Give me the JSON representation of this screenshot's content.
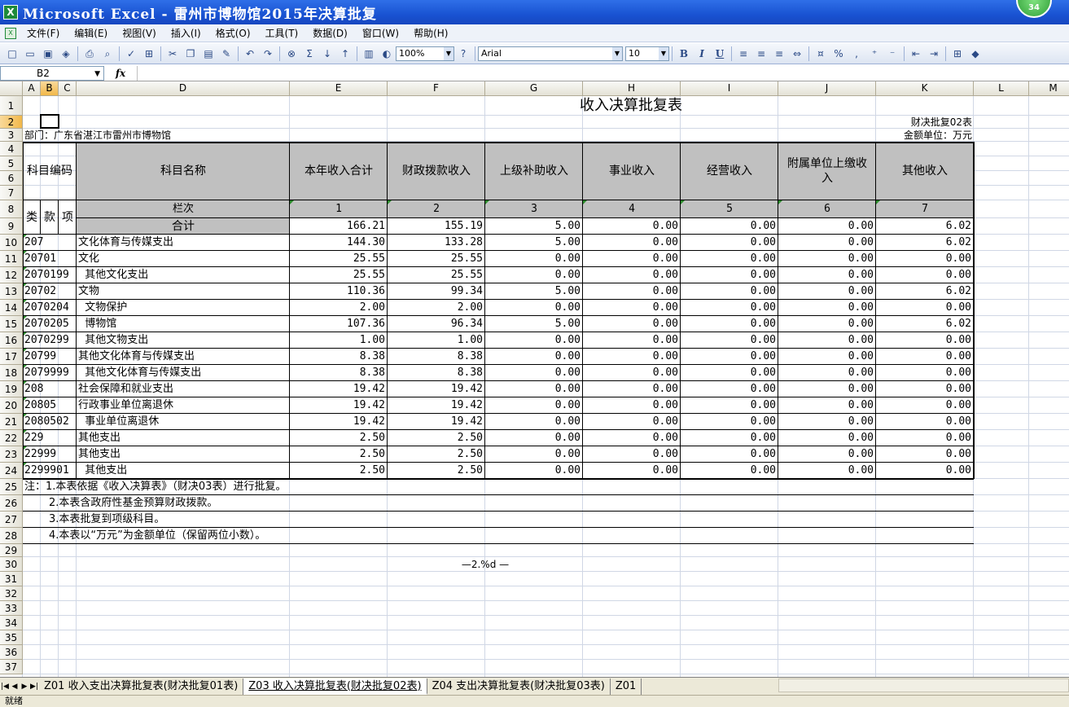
{
  "window": {
    "title": "Microsoft Excel - 雷州市博物馆2015年决算批复",
    "badge": "34"
  },
  "menu": [
    "文件(F)",
    "编辑(E)",
    "视图(V)",
    "插入(I)",
    "格式(O)",
    "工具(T)",
    "数据(D)",
    "窗口(W)",
    "帮助(H)"
  ],
  "toolbar": {
    "zoom": "100%",
    "font_name": "Arial",
    "font_size": "10",
    "bold": "B",
    "italic": "I",
    "underline": "U",
    "sigma": "Σ",
    "percent": "%",
    "comma": ","
  },
  "formula_bar": {
    "name_box": "B2",
    "fx": "fx",
    "formula": ""
  },
  "columns": [
    "A",
    "B",
    "C",
    "D",
    "E",
    "F",
    "G",
    "H",
    "I",
    "J",
    "K",
    "L",
    "M"
  ],
  "selected_column": "B",
  "selected_row": "2",
  "sheet": {
    "title": "收入决算批复表",
    "form_code": "财决批复02表",
    "department": "部门：广东省湛江市雷州市博物馆",
    "unit": "金额单位：万元",
    "header": {
      "code": "科目编码",
      "name": "科目名称",
      "cols": [
        "本年收入合计",
        "财政拨款收入",
        "上级补助收入",
        "事业收入",
        "经营收入",
        "附属单位上缴收入",
        "其他收入"
      ],
      "sub": [
        "类",
        "款",
        "项"
      ],
      "row8_label": "栏次",
      "col_numbers": [
        "1",
        "2",
        "3",
        "4",
        "5",
        "6",
        "7"
      ]
    },
    "total": {
      "name": "合计",
      "values": [
        "166.21",
        "155.19",
        "5.00",
        "0.00",
        "0.00",
        "0.00",
        "6.02"
      ]
    },
    "rows": [
      {
        "code": "207",
        "name": "文化体育与传媒支出",
        "values": [
          "144.30",
          "133.28",
          "5.00",
          "0.00",
          "0.00",
          "0.00",
          "6.02"
        ]
      },
      {
        "code": "20701",
        "name": "文化",
        "values": [
          "25.55",
          "25.55",
          "0.00",
          "0.00",
          "0.00",
          "0.00",
          "0.00"
        ]
      },
      {
        "code": "2070199",
        "name": "  其他文化支出",
        "values": [
          "25.55",
          "25.55",
          "0.00",
          "0.00",
          "0.00",
          "0.00",
          "0.00"
        ]
      },
      {
        "code": "20702",
        "name": "文物",
        "values": [
          "110.36",
          "99.34",
          "5.00",
          "0.00",
          "0.00",
          "0.00",
          "6.02"
        ]
      },
      {
        "code": "2070204",
        "name": "  文物保护",
        "values": [
          "2.00",
          "2.00",
          "0.00",
          "0.00",
          "0.00",
          "0.00",
          "0.00"
        ]
      },
      {
        "code": "2070205",
        "name": "  博物馆",
        "values": [
          "107.36",
          "96.34",
          "5.00",
          "0.00",
          "0.00",
          "0.00",
          "6.02"
        ]
      },
      {
        "code": "2070299",
        "name": "  其他文物支出",
        "values": [
          "1.00",
          "1.00",
          "0.00",
          "0.00",
          "0.00",
          "0.00",
          "0.00"
        ]
      },
      {
        "code": "20799",
        "name": "其他文化体育与传媒支出",
        "values": [
          "8.38",
          "8.38",
          "0.00",
          "0.00",
          "0.00",
          "0.00",
          "0.00"
        ]
      },
      {
        "code": "2079999",
        "name": "  其他文化体育与传媒支出",
        "values": [
          "8.38",
          "8.38",
          "0.00",
          "0.00",
          "0.00",
          "0.00",
          "0.00"
        ]
      },
      {
        "code": "208",
        "name": "社会保障和就业支出",
        "values": [
          "19.42",
          "19.42",
          "0.00",
          "0.00",
          "0.00",
          "0.00",
          "0.00"
        ]
      },
      {
        "code": "20805",
        "name": "行政事业单位离退休",
        "values": [
          "19.42",
          "19.42",
          "0.00",
          "0.00",
          "0.00",
          "0.00",
          "0.00"
        ]
      },
      {
        "code": "2080502",
        "name": "  事业单位离退休",
        "values": [
          "19.42",
          "19.42",
          "0.00",
          "0.00",
          "0.00",
          "0.00",
          "0.00"
        ]
      },
      {
        "code": "229",
        "name": "其他支出",
        "values": [
          "2.50",
          "2.50",
          "0.00",
          "0.00",
          "0.00",
          "0.00",
          "0.00"
        ]
      },
      {
        "code": "22999",
        "name": "其他支出",
        "values": [
          "2.50",
          "2.50",
          "0.00",
          "0.00",
          "0.00",
          "0.00",
          "0.00"
        ]
      },
      {
        "code": "2299901",
        "name": "  其他支出",
        "values": [
          "2.50",
          "2.50",
          "0.00",
          "0.00",
          "0.00",
          "0.00",
          "0.00"
        ]
      }
    ],
    "notes": [
      "注：1.本表依据《收入决算表》（财决03表）进行批复。",
      "2.本表含政府性基金预算财政拨款。",
      "3.本表批复到项级科目。",
      "4.本表以“万元”为金额单位（保留两位小数）。"
    ],
    "footer": "—2.%d —"
  },
  "row_numbers": [
    "1",
    "2",
    "3",
    "4",
    "5",
    "6",
    "7",
    "8",
    "9",
    "10",
    "11",
    "12",
    "13",
    "14",
    "15",
    "16",
    "17",
    "18",
    "19",
    "20",
    "21",
    "22",
    "23",
    "24",
    "25",
    "26",
    "27",
    "28",
    "29",
    "30",
    "31",
    "32",
    "33",
    "34",
    "35",
    "36",
    "37"
  ],
  "sheet_tabs": [
    {
      "label": "Z01 收入支出决算批复表(财决批复01表)",
      "active": false
    },
    {
      "label": "Z03 收入决算批复表(财决批复02表)",
      "active": true
    },
    {
      "label": "Z04 支出决算批复表(财决批复03表)",
      "active": false
    },
    {
      "label": "Z01",
      "active": false
    }
  ],
  "status": "就绪",
  "colors": {
    "titlebar": "#1953d2",
    "header_fill": "#c0c0c0",
    "selected_header": "#f2b84a",
    "gridline": "#d0d7e5"
  }
}
